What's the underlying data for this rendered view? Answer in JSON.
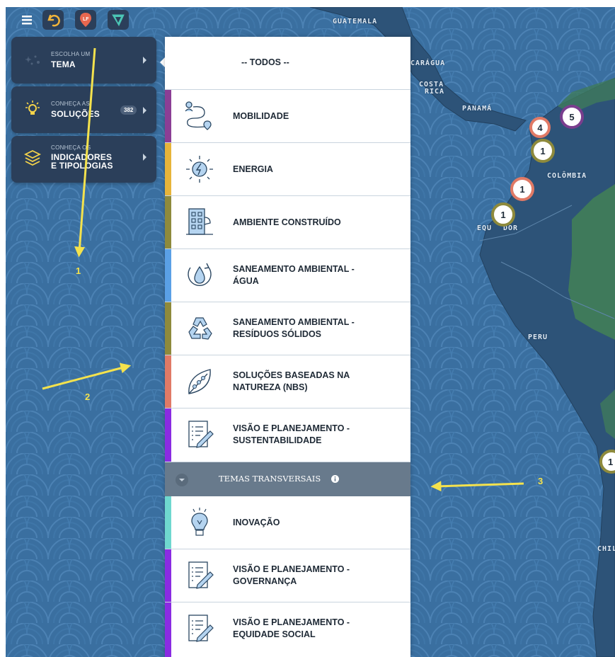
{
  "toolbar": {
    "items": [
      {
        "name": "menu-icon"
      },
      {
        "name": "undo-icon"
      },
      {
        "name": "brand-pin-icon"
      },
      {
        "name": "filter-icon"
      }
    ]
  },
  "sidebar": {
    "items": [
      {
        "small": "ESCOLHA UM",
        "title_lines": [
          "TEMA"
        ],
        "icon": "sparkle-icon"
      },
      {
        "small": "CONHEÇA AS",
        "title_lines": [
          "SOLUÇÕES"
        ],
        "badge": "382",
        "icon": "lightbulb-icon"
      },
      {
        "small": "CONHEÇA OS",
        "title_lines": [
          "INDICADORES",
          "E TIPOLOGIAS"
        ],
        "icon": "layers-icon"
      }
    ]
  },
  "menu": {
    "todos": "-- TODOS --",
    "items": [
      {
        "lines": [
          "MOBILIDADE"
        ],
        "icon": "route-icon",
        "color": "#8b3e95"
      },
      {
        "lines": [
          "ENERGIA"
        ],
        "icon": "energy-icon",
        "color": "#e7b43a"
      },
      {
        "lines": [
          "AMBIENTE CONSTRUÍDO"
        ],
        "icon": "building-icon",
        "color": "#8e8a3c"
      },
      {
        "lines": [
          "SANEAMENTO AMBIENTAL -",
          "ÁGUA"
        ],
        "icon": "water-drop-icon",
        "color": "#5aa0e6"
      },
      {
        "lines": [
          "SANEAMENTO AMBIENTAL -",
          "RESÍDUOS SÓLIDOS"
        ],
        "icon": "recycle-icon",
        "color": "#8e8a3c"
      },
      {
        "lines": [
          "SOLUÇÕES BASEADAS NA",
          "NATUREZA (NBS)"
        ],
        "icon": "leaf-icon",
        "color": "#e07a66"
      },
      {
        "lines": [
          "VISÃO E PLANEJAMENTO -",
          "SUSTENTABILIDADE"
        ],
        "icon": "plan-icon",
        "color": "#8a2be2"
      }
    ],
    "transversal": {
      "label": "TEMAS TRANSVERSAIS",
      "icon": "info-icon"
    },
    "transversal_items": [
      {
        "lines": [
          "INOVAÇÃO"
        ],
        "icon": "idea-icon",
        "color": "#6fd8cf"
      },
      {
        "lines": [
          "VISÃO E PLANEJAMENTO -",
          "GOVERNANÇA"
        ],
        "icon": "plan-icon",
        "color": "#8a2be2"
      },
      {
        "lines": [
          "VISÃO E PLANEJAMENTO -",
          "EQUIDADE SOCIAL"
        ],
        "icon": "plan-icon",
        "color": "#8a2be2"
      }
    ]
  },
  "map": {
    "countries": [
      "GUATEMALA",
      "CARÁGUA",
      "COSTA",
      "RICA",
      "PANAMÁ",
      "COLÔMBIA",
      "EQU",
      "DOR",
      "PERU",
      "CHIL"
    ],
    "clusters": [
      {
        "count": "5",
        "ring": "#7a3e8e"
      },
      {
        "count": "4",
        "ring": "#e07a66"
      },
      {
        "count": "1",
        "ring": "#8e8a3c"
      },
      {
        "count": "1",
        "ring": "#e07a66"
      },
      {
        "count": "1",
        "ring": "#8e8a3c"
      },
      {
        "count": "1",
        "ring": "#8e8a3c"
      }
    ]
  },
  "annotations": [
    "1",
    "2",
    "3"
  ],
  "colors": {
    "ocean": "#3a6fa0",
    "land": "#2d5378",
    "forest": "#3f7a5b",
    "panel": "#2b3f5a",
    "annotation": "#f4e24d"
  }
}
